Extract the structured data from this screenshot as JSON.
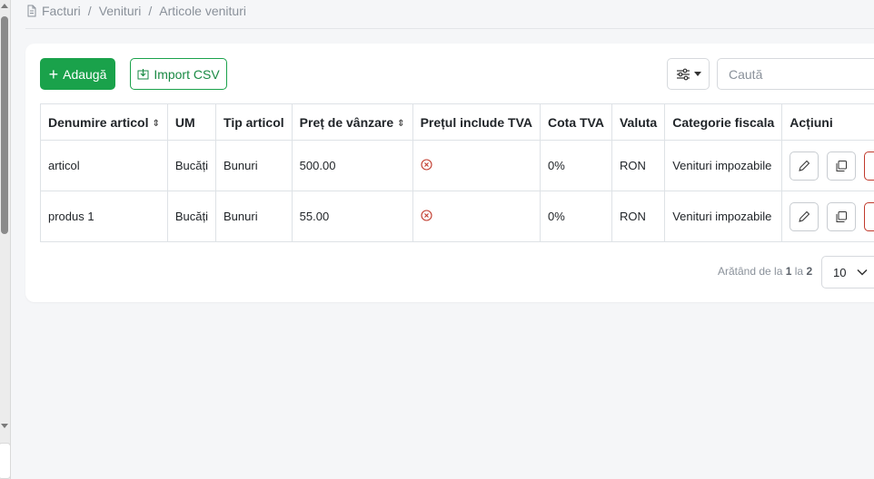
{
  "breadcrumb": {
    "items": [
      "Facturi",
      "Venituri",
      "Articole venituri"
    ],
    "separator": "/"
  },
  "toolbar": {
    "add_label": "Adaugă",
    "import_label": "Import CSV",
    "search_placeholder": "Caută"
  },
  "table": {
    "columns": [
      {
        "label": "Denumire articol",
        "sortable": true
      },
      {
        "label": "UM",
        "sortable": false
      },
      {
        "label": "Tip articol",
        "sortable": false
      },
      {
        "label": "Preț de vânzare",
        "sortable": true
      },
      {
        "label": "Prețul include TVA",
        "sortable": false
      },
      {
        "label": "Cota TVA",
        "sortable": false
      },
      {
        "label": "Valuta",
        "sortable": false
      },
      {
        "label": "Categorie fiscala",
        "sortable": false
      },
      {
        "label": "Acțiuni",
        "sortable": false
      }
    ],
    "rows": [
      {
        "name": "articol",
        "um": "Bucăți",
        "type": "Bunuri",
        "price": "500.00",
        "vat_included": false,
        "vat_rate": "0%",
        "currency": "RON",
        "category": "Venituri impozabile"
      },
      {
        "name": "produs 1",
        "um": "Bucăți",
        "type": "Bunuri",
        "price": "55.00",
        "vat_included": false,
        "vat_rate": "0%",
        "currency": "RON",
        "category": "Venituri impozabile"
      }
    ]
  },
  "pagination": {
    "prefix": "Arătând de la",
    "from": "1",
    "middle": "la",
    "to": "2",
    "page_size": "10"
  },
  "colors": {
    "primary": "#1aa24b",
    "danger": "#c0392b"
  }
}
